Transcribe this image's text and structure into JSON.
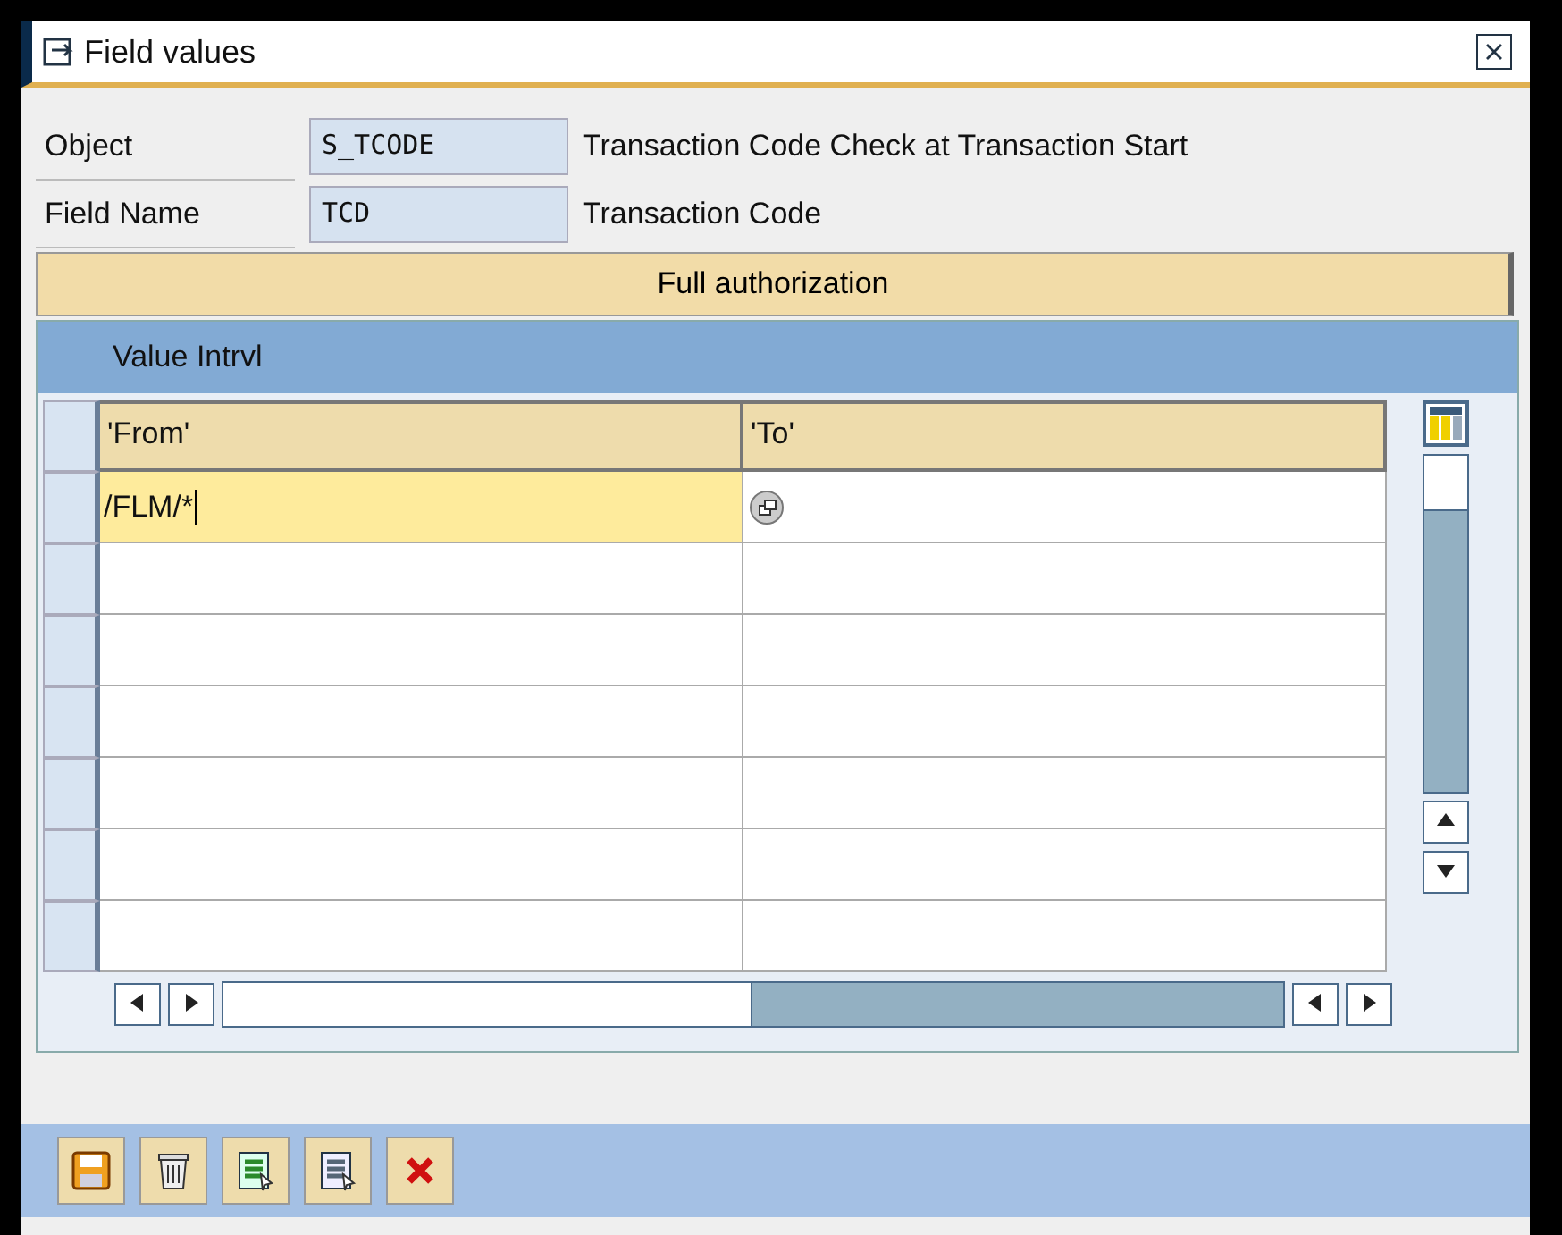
{
  "window": {
    "title": "Field values"
  },
  "fields": [
    {
      "label": "Object",
      "value": "S_TCODE",
      "description": "Transaction Code Check at Transaction Start"
    },
    {
      "label": "Field Name",
      "value": "TCD",
      "description": "Transaction Code"
    }
  ],
  "full_authorization_button": "Full authorization",
  "table": {
    "title": "Value Intrvl",
    "columns": [
      "'From'",
      "'To'"
    ],
    "rows": [
      {
        "from": "/FLM/*",
        "focused": true
      },
      {
        "focused": false
      },
      {
        "focused": false
      },
      {
        "focused": false
      },
      {
        "focused": false
      },
      {
        "focused": false
      },
      {
        "focused": false
      }
    ]
  }
}
